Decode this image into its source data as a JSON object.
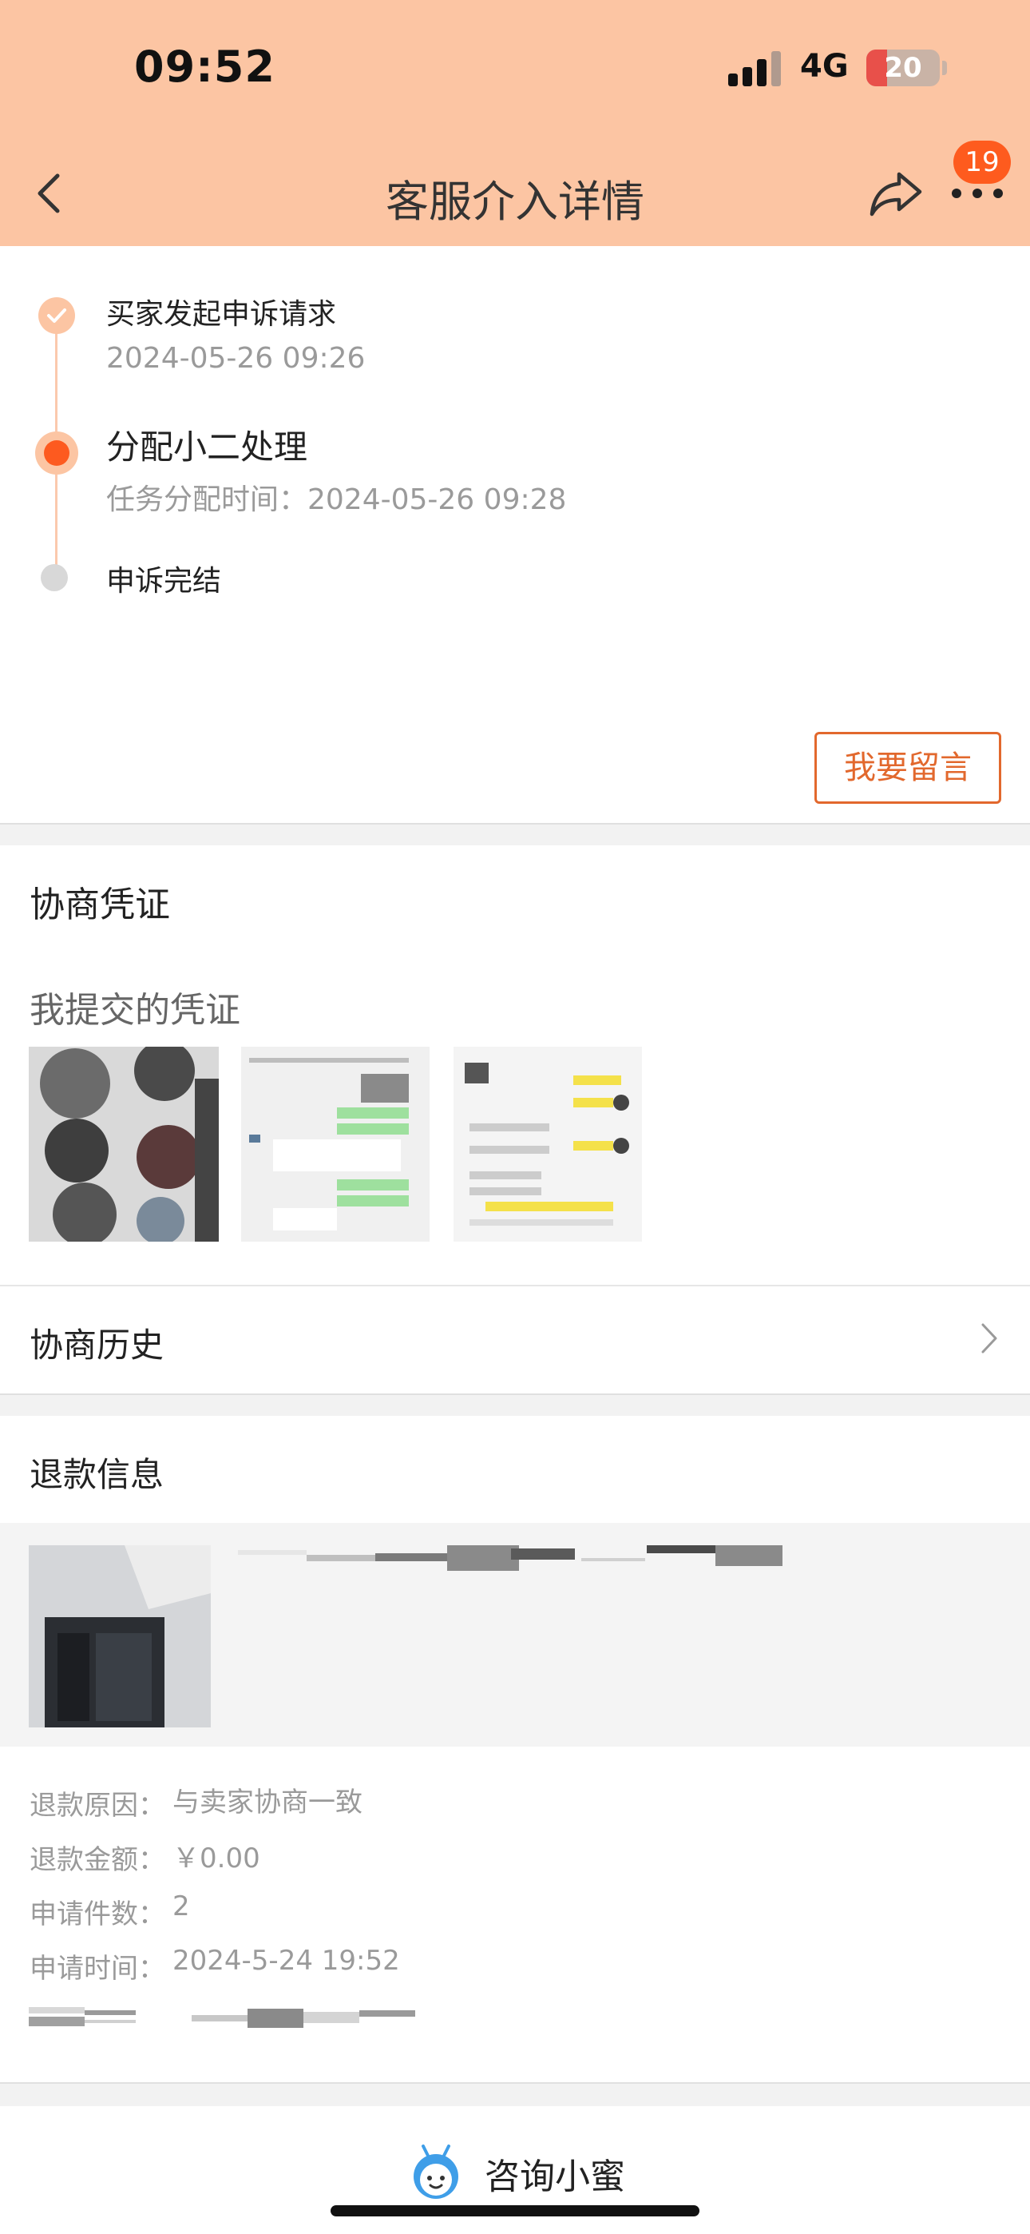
{
  "status_bar": {
    "time": "09:52",
    "network": "4G",
    "battery_level": "20"
  },
  "header": {
    "title": "客服介入详情",
    "badge_count": "19"
  },
  "timeline": {
    "steps": [
      {
        "title": "买家发起申诉请求",
        "subtitle": "2024-05-26 09:26",
        "state": "done"
      },
      {
        "title": "分配小二处理",
        "subtitle": "任务分配时间：2024-05-26 09:28",
        "state": "active"
      },
      {
        "title": "申诉完结",
        "subtitle": "",
        "state": "pending"
      }
    ]
  },
  "message_button": "我要留言",
  "evidence": {
    "heading": "协商凭证",
    "subheading": "我提交的凭证"
  },
  "history": {
    "label": "协商历史"
  },
  "refund": {
    "heading": "退款信息",
    "reason_label": "退款原因：",
    "reason_value": "与卖家协商一致",
    "amount_label": "退款金额：",
    "amount_value": "￥0.00",
    "quantity_label": "申请件数：",
    "quantity_value": "2",
    "time_label": "申请时间：",
    "time_value": "2024-5-24 19:52"
  },
  "bottom": {
    "consult_label": "咨询小蜜"
  },
  "colors": {
    "header_bg": "#fcc5a3",
    "accent": "#fd5a1f",
    "button_border": "#e2682d",
    "badge": "#fe5b1e"
  }
}
